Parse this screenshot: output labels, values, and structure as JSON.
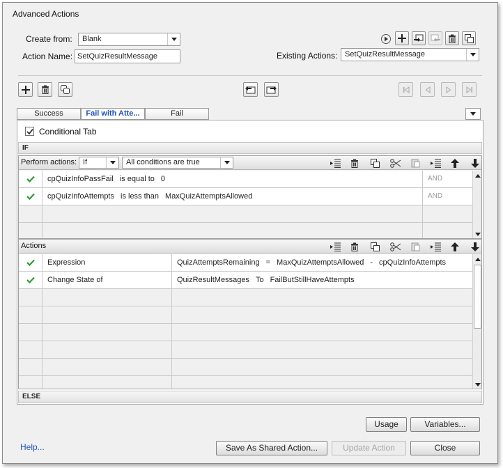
{
  "window": {
    "title": "Advanced Actions"
  },
  "create_from": {
    "label": "Create from:",
    "value": "Blank"
  },
  "action_name": {
    "label": "Action Name:",
    "value": "SetQuizResultMessage"
  },
  "existing_actions": {
    "label": "Existing Actions:",
    "value": "SetQuizResultMessage"
  },
  "tabs": [
    {
      "label": "Success"
    },
    {
      "label": "Fail with Atte..."
    },
    {
      "label": "Fail"
    }
  ],
  "conditional_tab": {
    "label": "Conditional Tab",
    "checked": true
  },
  "if_section": {
    "label": "IF",
    "perform_label": "Perform actions:",
    "perform_value": "If",
    "condition_value": "All conditions are true",
    "rows": [
      {
        "words": [
          "cpQuizInfoPassFail",
          "is equal to",
          "0"
        ],
        "operator": "AND"
      },
      {
        "words": [
          "cpQuizInfoAttempts",
          "is less than",
          "MaxQuizAttemptsAllowed"
        ],
        "operator": "AND"
      }
    ]
  },
  "actions_section": {
    "label": "Actions",
    "rows": [
      {
        "action": "Expression",
        "words": [
          "QuizAttemptsRemaining",
          "=",
          "MaxQuizAttemptsAllowed",
          "-",
          "cpQuizInfoAttempts"
        ]
      },
      {
        "action": "Change State of",
        "words": [
          "QuizResultMessages",
          "To",
          "FailButStillHaveAttempts"
        ]
      }
    ]
  },
  "else_section": {
    "label": "ELSE"
  },
  "buttons": {
    "usage": "Usage",
    "variables": "Variables...",
    "save_shared": "Save As Shared Action...",
    "update": "Update Action",
    "close": "Close",
    "help": "Help..."
  },
  "colors": {
    "check_green": "#2e9a2e",
    "active_tab_text": "#1e4fc2",
    "link": "#2255bb"
  }
}
